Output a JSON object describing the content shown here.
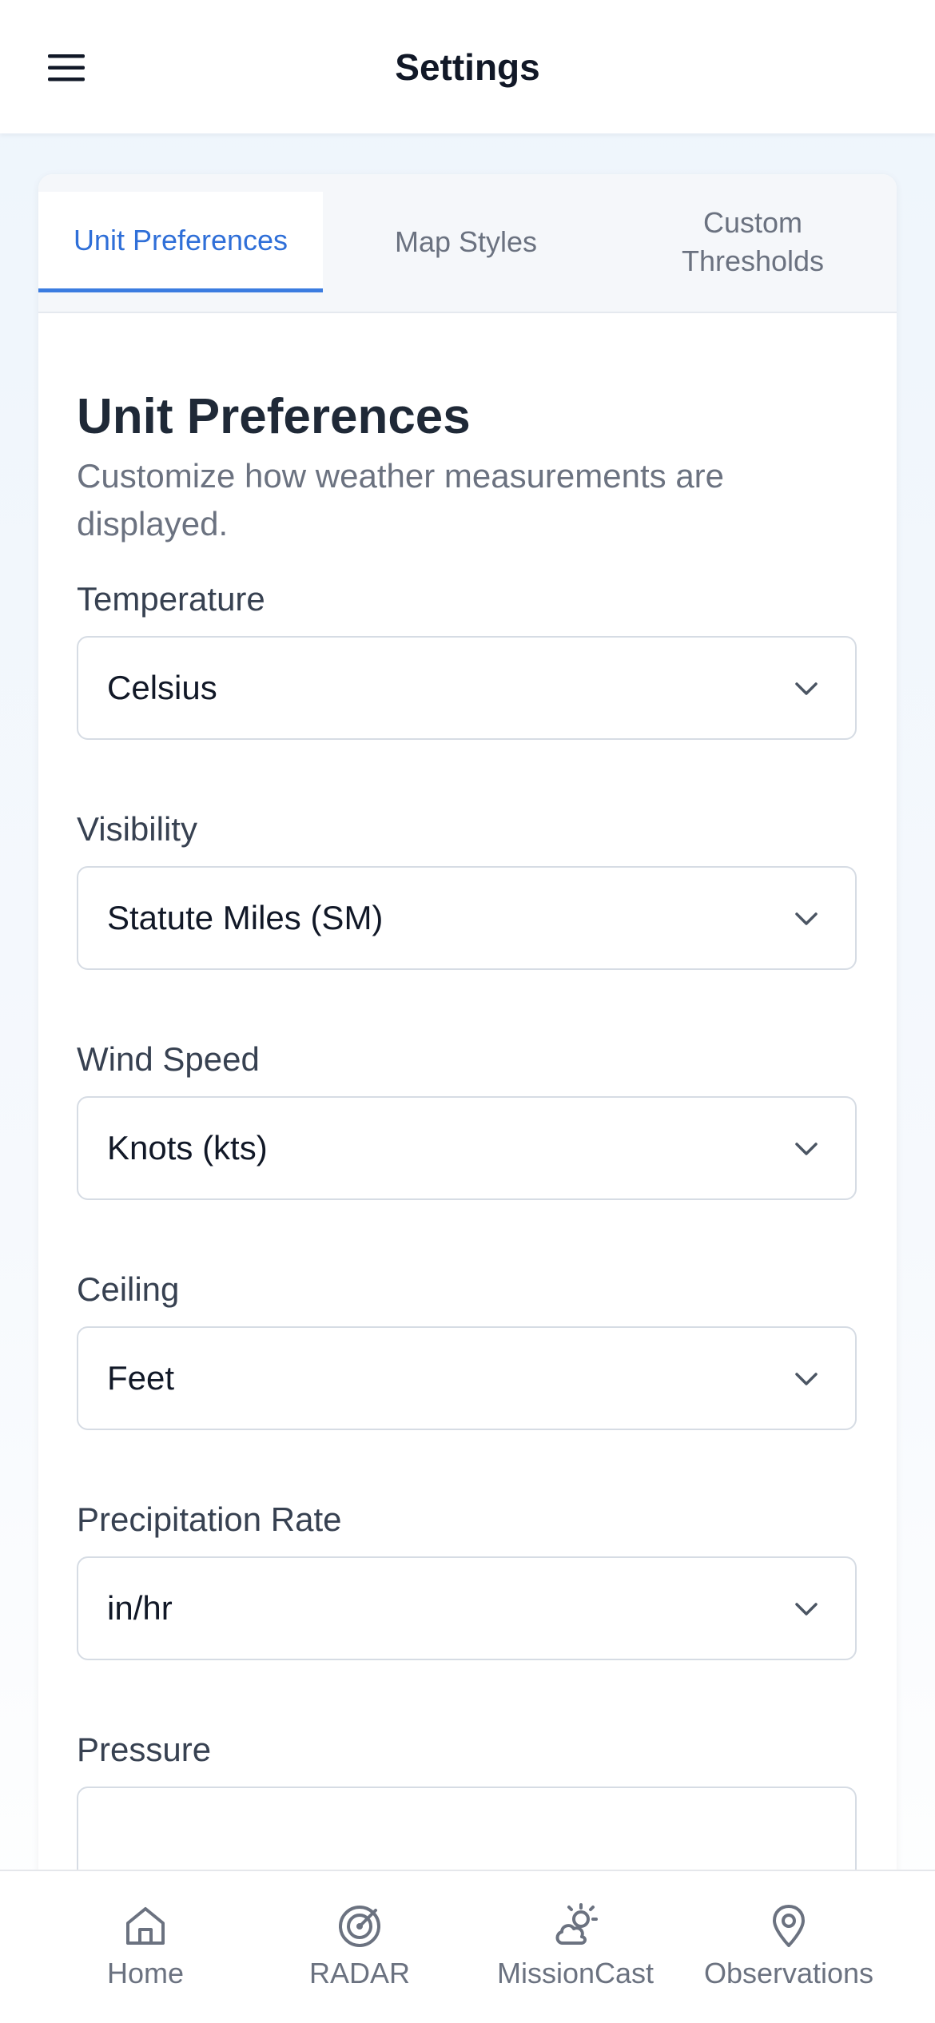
{
  "header": {
    "title": "Settings",
    "menu_icon": "hamburger-menu-icon"
  },
  "tabs": [
    {
      "label": "Unit Preferences",
      "active": true
    },
    {
      "label": "Map Styles",
      "active": false
    },
    {
      "label": "Custom Thresholds",
      "active": false
    }
  ],
  "section": {
    "title": "Unit Preferences",
    "description": "Customize how weather measurements are displayed."
  },
  "fields": [
    {
      "label": "Temperature",
      "value": "Celsius"
    },
    {
      "label": "Visibility",
      "value": "Statute Miles (SM)"
    },
    {
      "label": "Wind Speed",
      "value": "Knots (kts)"
    },
    {
      "label": "Ceiling",
      "value": "Feet"
    },
    {
      "label": "Precipitation Rate",
      "value": "in/hr"
    },
    {
      "label": "Pressure",
      "value": ""
    }
  ],
  "bottom_nav": [
    {
      "label": "Home",
      "icon": "home-icon"
    },
    {
      "label": "RADAR",
      "icon": "radar-icon"
    },
    {
      "label": "MissionCast",
      "icon": "weather-cloud-sun-icon"
    },
    {
      "label": "Observations",
      "icon": "map-pin-icon"
    }
  ],
  "colors": {
    "accent": "#2f6fd8",
    "tab_underline": "#3b7ce0",
    "muted_text": "#6b7280",
    "nav_icon": "#6b7280"
  }
}
